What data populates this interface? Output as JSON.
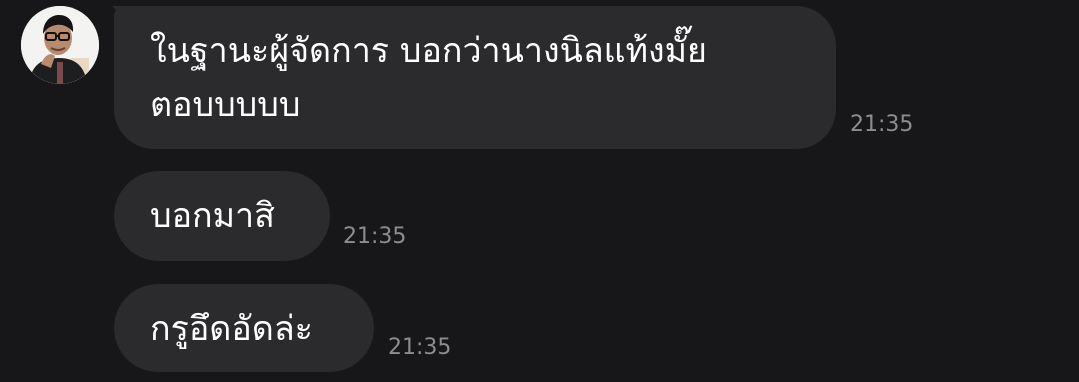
{
  "chat": {
    "sender_avatar_icon": "person-with-glasses-avatar",
    "messages": [
      {
        "lines": [
          "ในฐานะผู้จัดการ บอกว่านางนิลแท้งมั๊ย",
          "ตอบบบบบ"
        ],
        "time": "21:35"
      },
      {
        "lines": [
          "บอกมาสิ"
        ],
        "time": "21:35"
      },
      {
        "lines": [
          "กรูอึดอัดล่ะ"
        ],
        "time": "21:35"
      }
    ]
  },
  "colors": {
    "background": "#171618",
    "bubble": "#2b2b2d",
    "text": "#ffffff",
    "timestamp": "#8d8d8f"
  }
}
